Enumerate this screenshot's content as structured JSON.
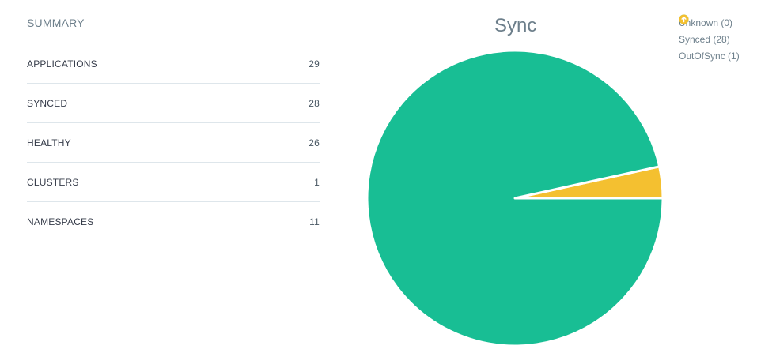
{
  "summary": {
    "title": "SUMMARY",
    "rows": [
      {
        "label": "APPLICATIONS",
        "value": "29"
      },
      {
        "label": "SYNCED",
        "value": "28"
      },
      {
        "label": "HEALTHY",
        "value": "26"
      },
      {
        "label": "CLUSTERS",
        "value": "1"
      },
      {
        "label": "NAMESPACES",
        "value": "11"
      }
    ]
  },
  "legend": [
    {
      "text": "Unknown (0)",
      "icon": "circle-outline-icon",
      "color": "#d4d9dd"
    },
    {
      "text": "Synced (28)",
      "icon": "check-circle-icon",
      "color": "#18be94"
    },
    {
      "text": "OutOfSync (1)",
      "icon": "arrow-up-circle-icon",
      "color": "#f4c030"
    }
  ],
  "chart_data": {
    "type": "pie",
    "title": "Sync",
    "categories": [
      "Unknown",
      "Synced",
      "OutOfSync"
    ],
    "values": [
      0,
      28,
      1
    ],
    "colors": [
      "#d4d9dd",
      "#18be94",
      "#f4c030"
    ],
    "legend_position": "top-right"
  }
}
